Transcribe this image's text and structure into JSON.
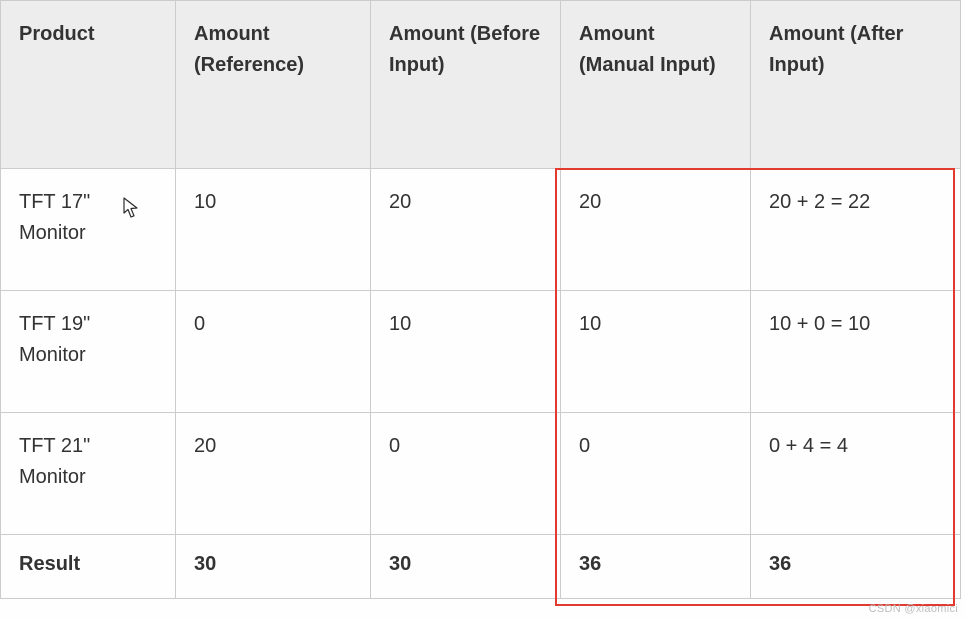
{
  "table": {
    "headers": [
      "Product",
      "Amount (Reference)",
      "Amount (Before Input)",
      "Amount (Manual Input)",
      "Amount (After Input)"
    ],
    "rows": [
      {
        "product": "TFT 17\" Monitor",
        "reference": "10",
        "before": "20",
        "manual": "20",
        "after": "20 + 2 = 22"
      },
      {
        "product": "TFT 19\" Monitor",
        "reference": "0",
        "before": "10",
        "manual": "10",
        "after": "10 + 0 = 10"
      },
      {
        "product": "TFT 21\" Monitor",
        "reference": "20",
        "before": "0",
        "manual": "0",
        "after": "0 + 4 = 4"
      }
    ],
    "result": {
      "label": "Result",
      "reference": "30",
      "before": "30",
      "manual": "36",
      "after": "36"
    }
  },
  "watermark": "CSDN @xiaomici"
}
